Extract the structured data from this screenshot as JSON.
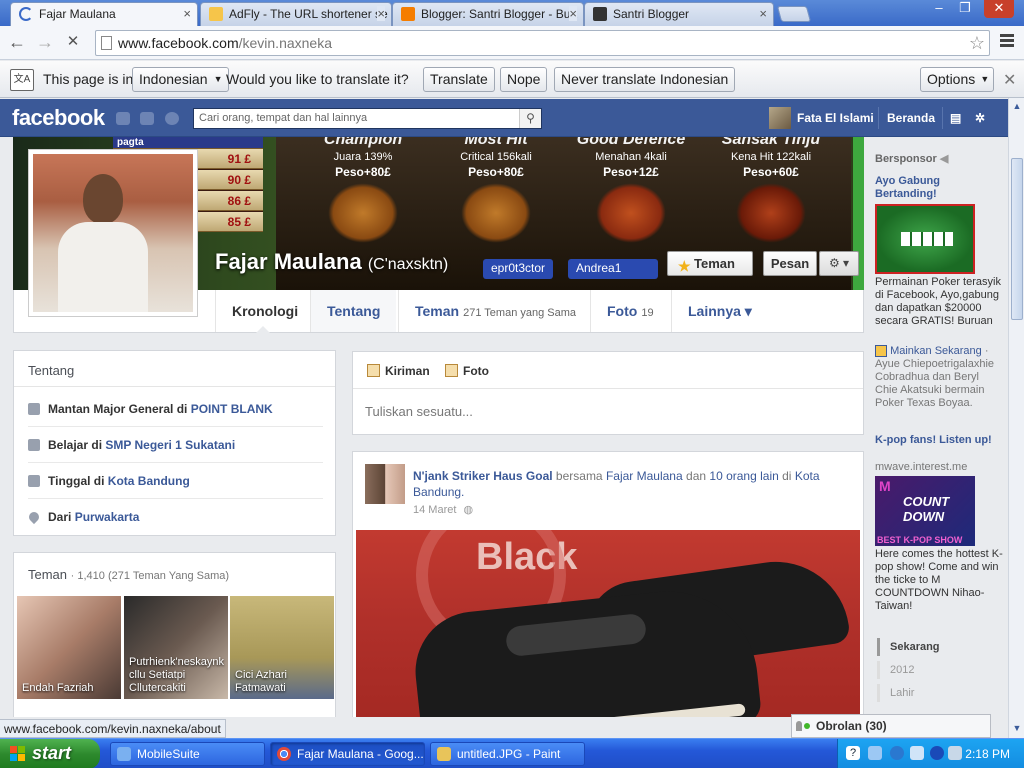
{
  "browser": {
    "tabs": [
      {
        "title": "Fajar Maulana",
        "active": true
      },
      {
        "title": "AdFly - The URL shortener se",
        "active": false
      },
      {
        "title": "Blogger: Santri Blogger - Bua",
        "active": false
      },
      {
        "title": "Santri Blogger",
        "active": false
      }
    ],
    "tab_close": "×",
    "url_host": "www.facebook.com",
    "url_path": "/kevin.naxneka",
    "window_controls": [
      "–",
      "❐",
      "✕"
    ],
    "nav": {
      "back": "←",
      "forward": "→",
      "stop": "✕"
    },
    "star": "☆"
  },
  "translate_bar": {
    "prefix": "This page is in",
    "language": "Indonesian",
    "question": "Would you like to translate it?",
    "translate": "Translate",
    "nope": "Nope",
    "never": "Never translate Indonesian",
    "options": "Options",
    "close": "✕"
  },
  "facebook": {
    "logo": "facebook",
    "search_placeholder": "Cari orang, tempat dan hal lainnya",
    "user_name": "Fata El Islami",
    "home": "Beranda",
    "profile": {
      "name": "Fajar Maulana",
      "alias": "(C'naxsktn)",
      "friend_button": "Teman",
      "message_button": "Pesan",
      "settings_button": "⚙ ▾",
      "cover_leaderboard": [
        {
          "label": "pagta",
          "value": ""
        },
        {
          "label": "",
          "value": "91 £"
        },
        {
          "label": "",
          "value": "90 £"
        },
        {
          "label": "",
          "value": "86 £"
        },
        {
          "label": "",
          "value": "85 £"
        }
      ],
      "cover_characters": [
        {
          "title": "Champion",
          "subtitle": "Juara 139%",
          "peso": "Peso+80£"
        },
        {
          "title": "Most Hit",
          "subtitle": "Critical 156kali",
          "peso": "Peso+80£"
        },
        {
          "title": "Good Defence",
          "subtitle": "Menahan 4kali",
          "peso": "Peso+12£"
        },
        {
          "title": "Sansak Tinju",
          "subtitle": "Kena Hit 122kali",
          "peso": "Peso+60£"
        }
      ],
      "cover_tags": [
        "epr0t3ctor",
        "Andrea1"
      ]
    },
    "timeline_nav": [
      {
        "label": "Kronologi",
        "count": ""
      },
      {
        "label": "Tentang",
        "count": ""
      },
      {
        "label": "Teman",
        "count": "271 Teman yang Sama"
      },
      {
        "label": "Foto",
        "count": "19"
      },
      {
        "label": "Lainnya ▾",
        "count": ""
      }
    ],
    "about": {
      "title": "Tentang",
      "rows": [
        {
          "prefix": "Mantan Major General di ",
          "link": "POINT BLANK"
        },
        {
          "prefix": "Belajar di ",
          "link": "SMP Negeri 1 Sukatani"
        },
        {
          "prefix": "Tinggal di ",
          "link": "Kota Bandung"
        },
        {
          "prefix": "Dari ",
          "link": "Purwakarta"
        }
      ]
    },
    "friends": {
      "title": "Teman",
      "count": "· 1,410 (271 Teman Yang Sama)",
      "tiles": [
        {
          "name": "Endah Fazriah"
        },
        {
          "name": "Putrhienk'neskaynk cllu Setiatpi Cllutercakiti"
        },
        {
          "name": "Cici Azhari Fatmawati"
        }
      ]
    },
    "composer": {
      "tab_post": "Kiriman",
      "tab_photo": "Foto",
      "placeholder": "Tuliskan sesuatu..."
    },
    "post": {
      "author": "N'jank Striker Haus Goal",
      "with": "bersama",
      "tagged": "Fajar Maulana",
      "and": "dan",
      "others": "10 orang lain",
      "at": "di",
      "place": "Kota Bandung.",
      "date": "14 Maret",
      "image_text": "Black"
    },
    "sidebar": {
      "sponsored": "Bersponsor",
      "ad1_title": "Ayo Gabung Bertanding!",
      "ad1_text": "Permainan Poker terasyik di Facebook, Ayo,gabung dan dapatkan $20000 secara GRATIS! Buruan",
      "ad1_action": "Mainkan Sekarang",
      "ad1_social": "· Ayue Chiepoetrigalaxhie Cobradhua dan Beryl Chie Akatsuki bermain Poker Texas Boyaa.",
      "ad2_title": "K-pop fans! Listen up!",
      "ad2_domain": "mwave.interest.me",
      "ad2_banner_top": "M",
      "ad2_banner_mid": "COUNT DOWN",
      "ad2_banner_bottom": "BEST K-POP SHOW",
      "ad2_text": "Here comes the hottest K-pop show! Come and win the ticke to M COUNTDOWN Nihao-Taiwan!",
      "years": [
        "Sekarang",
        "2012",
        "Lahir"
      ]
    },
    "chat": "Obrolan (30)"
  },
  "status_url": "www.facebook.com/kevin.naxneka/about",
  "taskbar": {
    "start": "start",
    "tasks": [
      {
        "label": "MobileSuite",
        "active": false
      },
      {
        "label": "Fajar Maulana - Goog...",
        "active": true
      },
      {
        "label": "untitled.JPG - Paint",
        "active": false
      }
    ],
    "clock": "2:18 PM"
  },
  "colors": {
    "facebook_blue": "#3b5998",
    "link": "#3b5998",
    "taskbar": "#245edb",
    "start_green": "#2e8a2e"
  }
}
